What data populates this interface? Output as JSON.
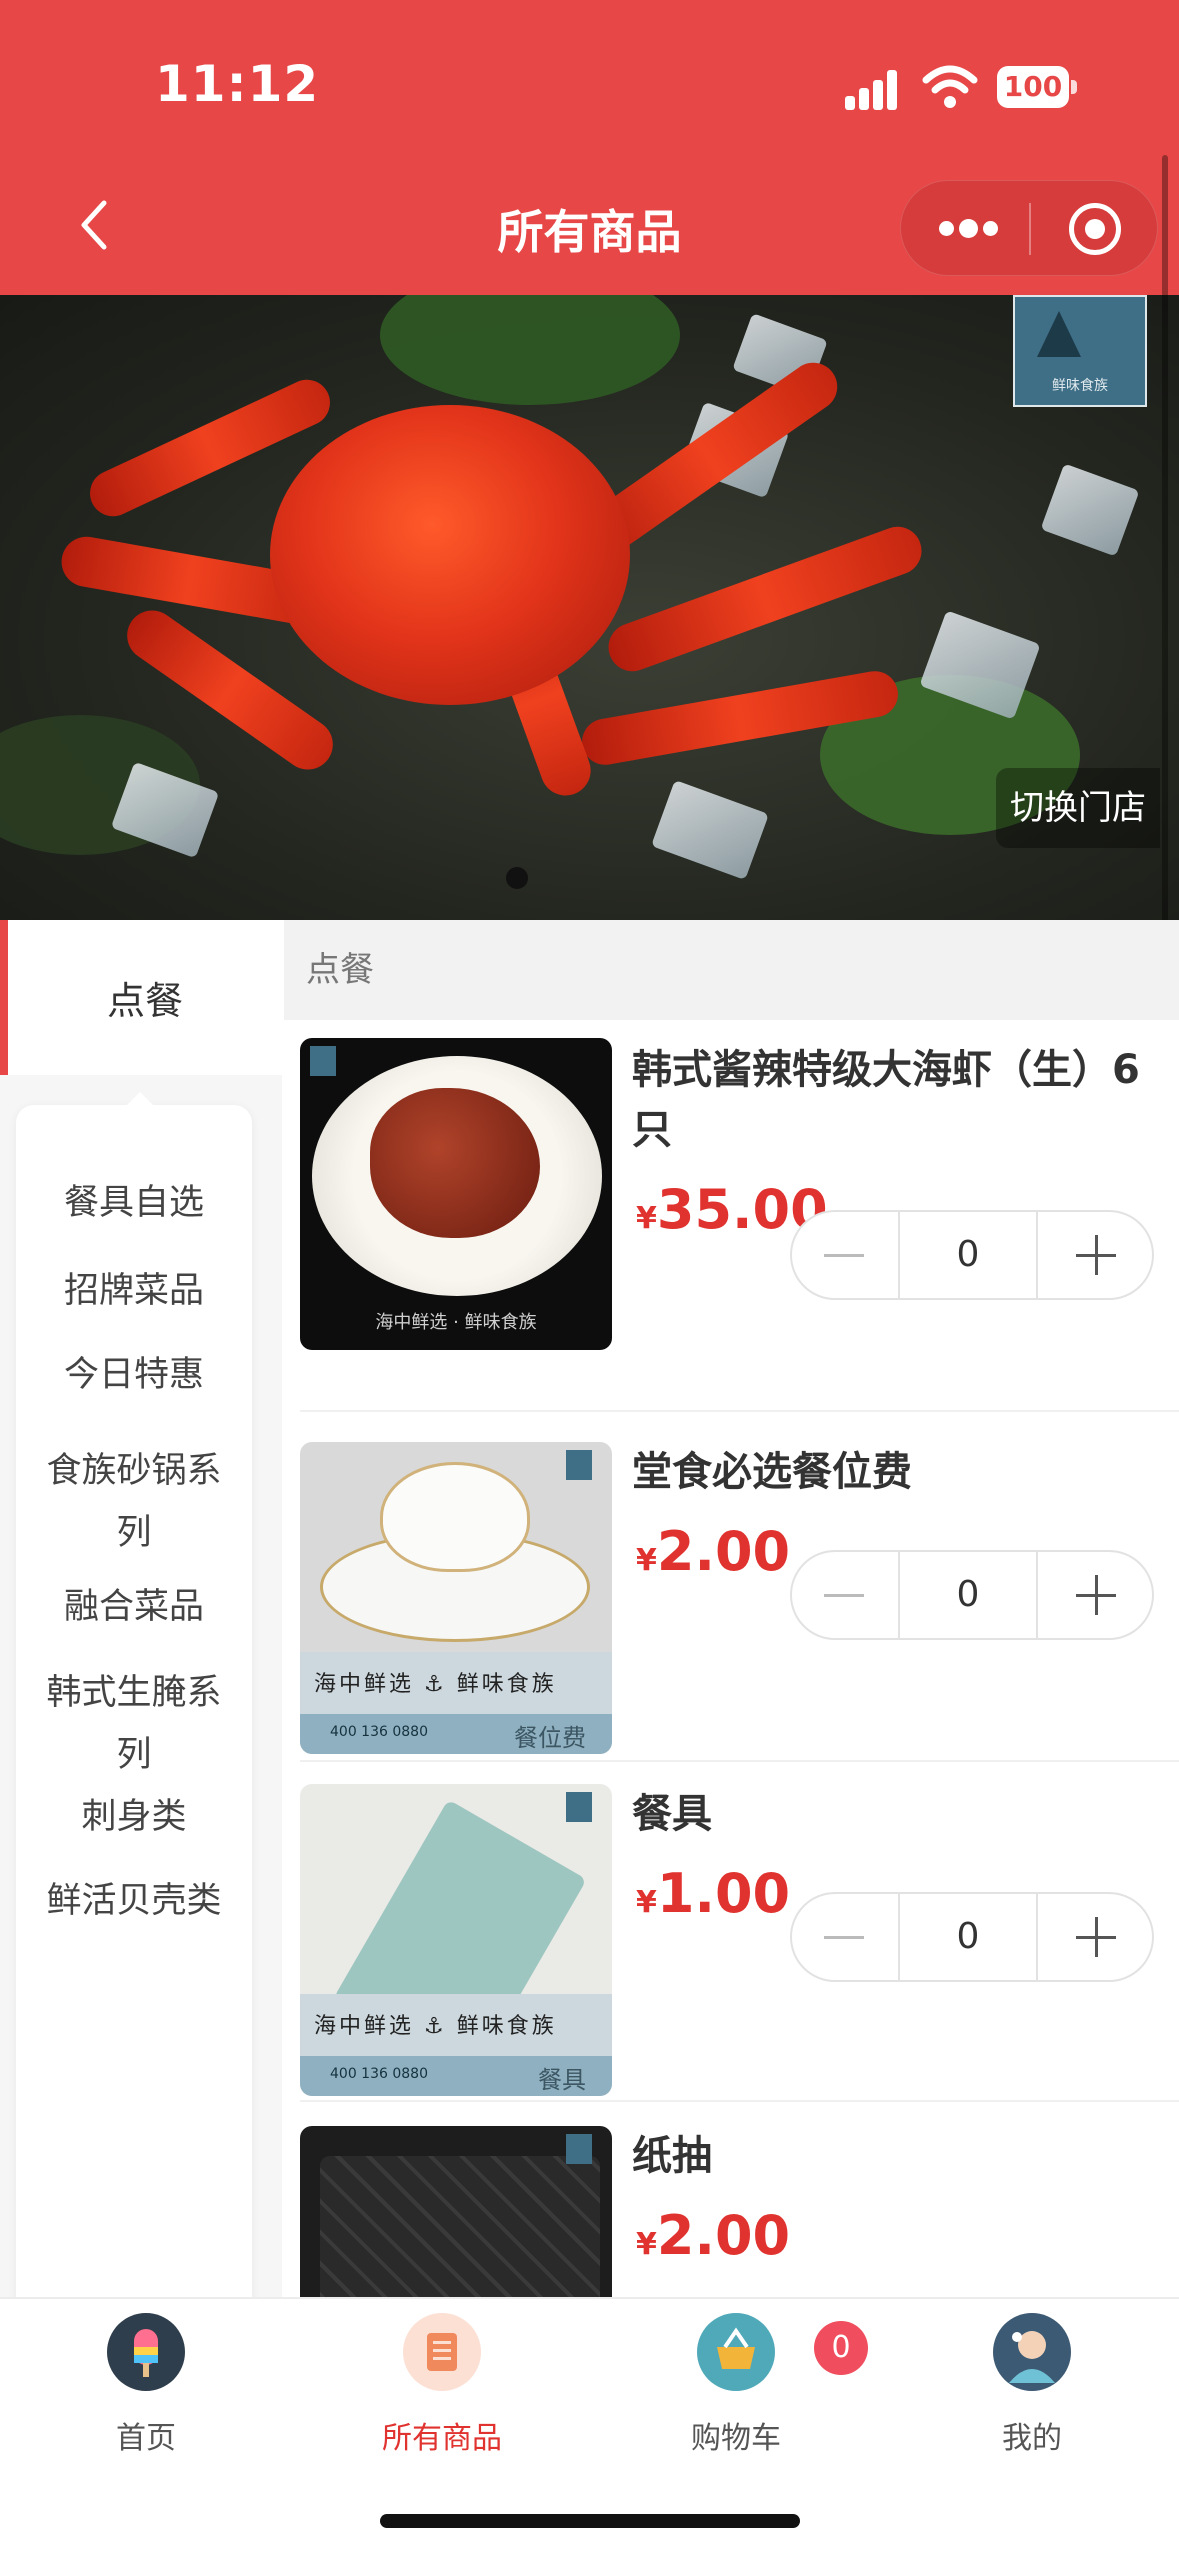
{
  "status_bar": {
    "time": "11:12",
    "battery": "100"
  },
  "nav": {
    "title": "所有商品"
  },
  "banner": {
    "switch_store": "切换门店",
    "logo_text": "鲜味食族"
  },
  "sidebar": {
    "active": "点餐",
    "items": [
      "餐具自选",
      "招牌菜品",
      "今日特惠",
      "食族砂锅系列",
      "融合菜品",
      "韩式生腌系列",
      "刺身类",
      "鲜活贝壳类"
    ]
  },
  "content": {
    "category_header": "点餐",
    "products": [
      {
        "name": "韩式酱辣特级大海虾（生）6只",
        "currency": "¥",
        "price": "35.00",
        "qty": "0"
      },
      {
        "name": "堂食必选餐位费",
        "currency": "¥",
        "price": "2.00",
        "qty": "0",
        "thumb_brand": "海中鲜选 ⚓ 鲜味食族",
        "thumb_phone": "400 136 0880",
        "thumb_tag": "餐位费"
      },
      {
        "name": "餐具",
        "currency": "¥",
        "price": "1.00",
        "qty": "0",
        "thumb_brand": "海中鲜选 ⚓ 鲜味食族",
        "thumb_phone": "400 136 0880",
        "thumb_tag": "餐具"
      },
      {
        "name": "纸抽",
        "currency": "¥",
        "price": "2.00"
      }
    ]
  },
  "tabbar": {
    "tabs": [
      {
        "label": "首页",
        "icon": "popsicle-icon"
      },
      {
        "label": "所有商品",
        "icon": "scroll-icon"
      },
      {
        "label": "购物车",
        "icon": "basket-icon"
      },
      {
        "label": "我的",
        "icon": "avatar-icon"
      }
    ],
    "cart_count": "0",
    "accent": "#e0332f"
  },
  "colors": {
    "header": "#e74747",
    "price": "#e0332f"
  }
}
